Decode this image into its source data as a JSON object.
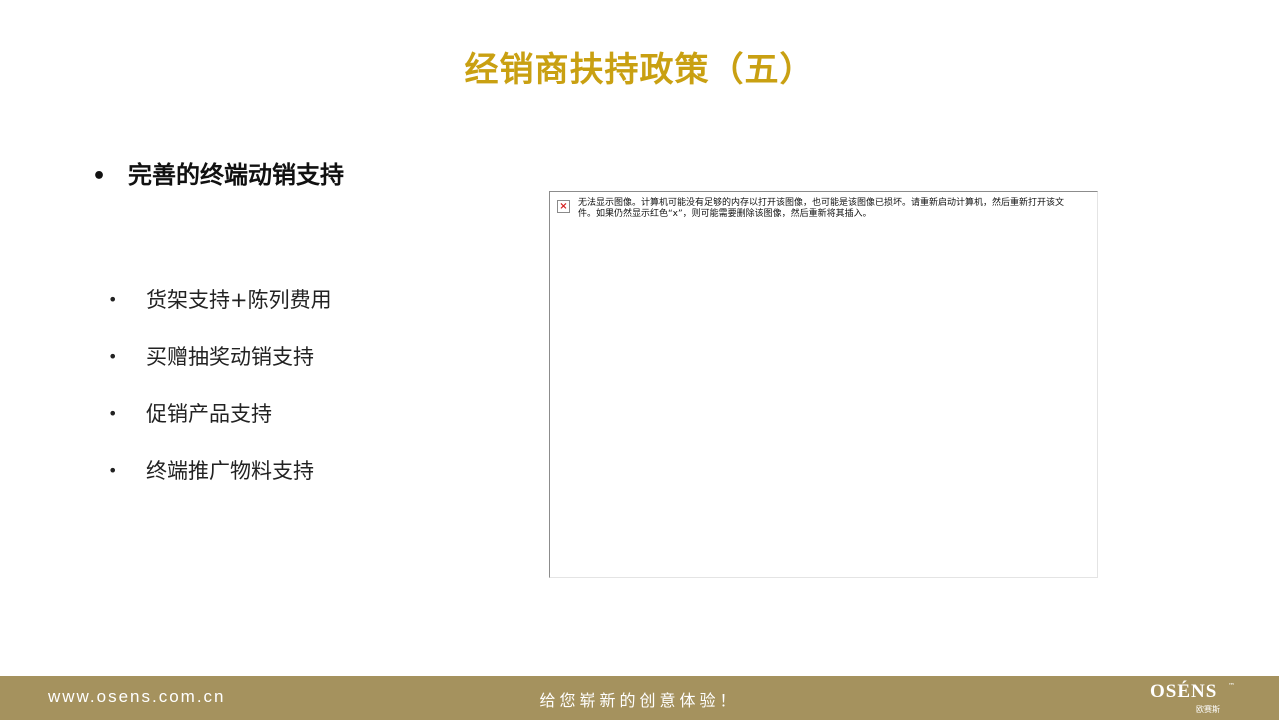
{
  "slide": {
    "title": "经销商扶持政策（五）",
    "main_point": "完善的终端动销支持",
    "bullet_glyph": "•",
    "sub_points": [
      "货架支持+陈列费用",
      "买赠抽奖动销支持",
      "促销产品支持",
      "终端推广物料支持"
    ]
  },
  "image_placeholder": {
    "icon_glyph": "×",
    "message": "无法显示图像。计算机可能没有足够的内存以打开该图像，也可能是该图像已损坏。请重新启动计算机，然后重新打开该文件。如果仍然显示红色“x”，则可能需要删除该图像，然后重新将其插入。"
  },
  "footer": {
    "url": "www.osens.com.cn",
    "slogan": "给您崭新的创意体验！",
    "logo_text": "OSÉNS",
    "logo_tm": "™",
    "logo_subtext": "欧赛斯"
  },
  "colors": {
    "title": "#c9a012",
    "footer_bg": "#a5925e",
    "error_x": "#d42020"
  }
}
